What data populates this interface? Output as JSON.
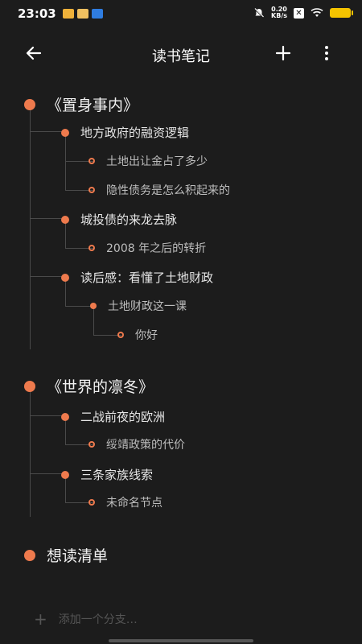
{
  "status": {
    "time": "23:03",
    "speed_top": "0.20",
    "speed_bottom": "KB/s"
  },
  "appbar": {
    "title": "读书笔记"
  },
  "tree": {
    "b1": {
      "title": "《置身事内》",
      "c1": {
        "label": "地方政府的融资逻辑",
        "g1": "土地出让金占了多少",
        "g2": "隐性债务是怎么积起来的"
      },
      "c2": {
        "label": "城投债的来龙去脉",
        "g1": "2008 年之后的转折"
      },
      "c3": {
        "label": "读后感：看懂了土地财政",
        "g1": "土地财政这一课",
        "gg1": "你好"
      }
    },
    "b2": {
      "title": "《世界的凛冬》",
      "c1": {
        "label": "二战前夜的欧洲",
        "g1": "绥靖政策的代价"
      },
      "c2": {
        "label": "三条家族线索",
        "g1": "未命名节点"
      }
    },
    "b3": {
      "title": "想读清单"
    }
  },
  "add_branch": {
    "label": "添加一个分支…"
  },
  "colors": {
    "accent": "#ee7a4d",
    "background": "#1c1c1c",
    "line": "#4a4a4a"
  },
  "icons": [
    "back-arrow-icon",
    "plus-icon",
    "more-vertical-icon"
  ]
}
